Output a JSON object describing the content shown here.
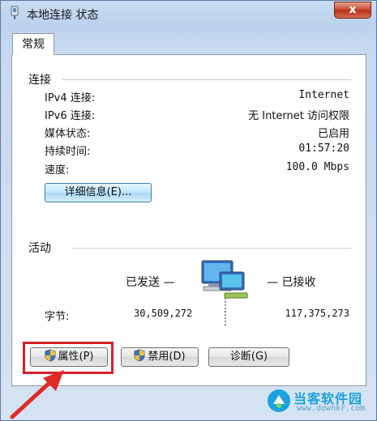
{
  "window": {
    "title": "本地连接 状态",
    "close_label": "x"
  },
  "tab": {
    "label": "常规"
  },
  "connection": {
    "section_title": "连接",
    "rows": [
      {
        "label": "IPv4 连接:",
        "value": "Internet"
      },
      {
        "label": "IPv6 连接:",
        "value": "无 Internet 访问权限"
      },
      {
        "label": "媒体状态:",
        "value": "已启用"
      },
      {
        "label": "持续时间:",
        "value": "01:57:20"
      },
      {
        "label": "速度:",
        "value": "100.0 Mbps"
      }
    ],
    "details_button": "详细信息(E)..."
  },
  "activity": {
    "section_title": "活动",
    "sent_label": "已发送 —",
    "received_label": "— 已接收",
    "bytes_label": "字节:",
    "bytes_sent": "30,509,272",
    "bytes_received": "117,375,273"
  },
  "buttons": {
    "properties": "属性(P)",
    "disable": "禁用(D)",
    "diagnose": "诊断(G)"
  },
  "watermark": {
    "text": "当客软件园",
    "url": "www.downkr.com"
  },
  "colors": {
    "highlight": "#d6202a",
    "accent": "#3c7fb1",
    "watermark": "#1aa2e0"
  }
}
